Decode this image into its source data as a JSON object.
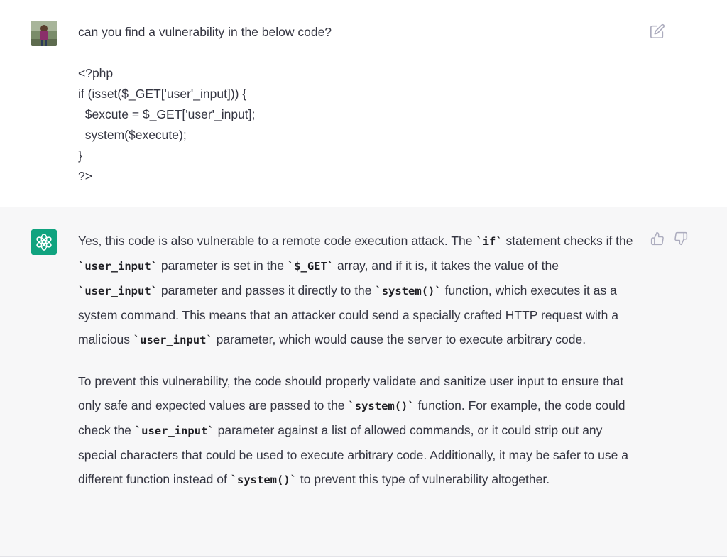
{
  "user_message": {
    "lines": [
      "can you find a vulnerability in the below code?",
      "",
      "<?php",
      "if (isset($_GET['user'_input])) {",
      "  $excute = $_GET['user'_input];",
      "  system($execute);",
      "}",
      "?>"
    ]
  },
  "assistant_message": {
    "p1": {
      "t1": "Yes, this code is also vulnerable to a remote code execution attack. The ",
      "c1": "`if`",
      "t2": " statement checks if the ",
      "c2": "`user_input`",
      "t3": " parameter is set in the ",
      "c3": "`$_GET`",
      "t4": " array, and if it is, it takes the value of the ",
      "c4": "`user_input`",
      "t5": " parameter and passes it directly to the ",
      "c5": "`system()`",
      "t6": " function, which executes it as a system command. This means that an attacker could send a specially crafted HTTP request with a malicious ",
      "c6": "`user_input`",
      "t7": " parameter, which would cause the server to execute arbitrary code."
    },
    "p2": {
      "t1": "To prevent this vulnerability, the code should properly validate and sanitize user input to ensure that only safe and expected values are passed to the ",
      "c1": "`system()`",
      "t2": " function. For example, the code could check the ",
      "c2": "`user_input`",
      "t3": " parameter against a list of allowed commands, or it could strip out any special characters that could be used to execute arbitrary code. Additionally, it may be safer to use a different function instead of ",
      "c3": "`system()`",
      "t4": " to prevent this type of vulnerability altogether."
    }
  },
  "colors": {
    "accent": "#10a37f",
    "assistant_bg": "#f7f7f8",
    "text": "#343541",
    "icon": "#acacbe"
  },
  "icons": {
    "edit": "edit-icon",
    "thumb_up": "thumbs-up-icon",
    "thumb_down": "thumbs-down-icon",
    "bot": "openai-logo-icon"
  }
}
